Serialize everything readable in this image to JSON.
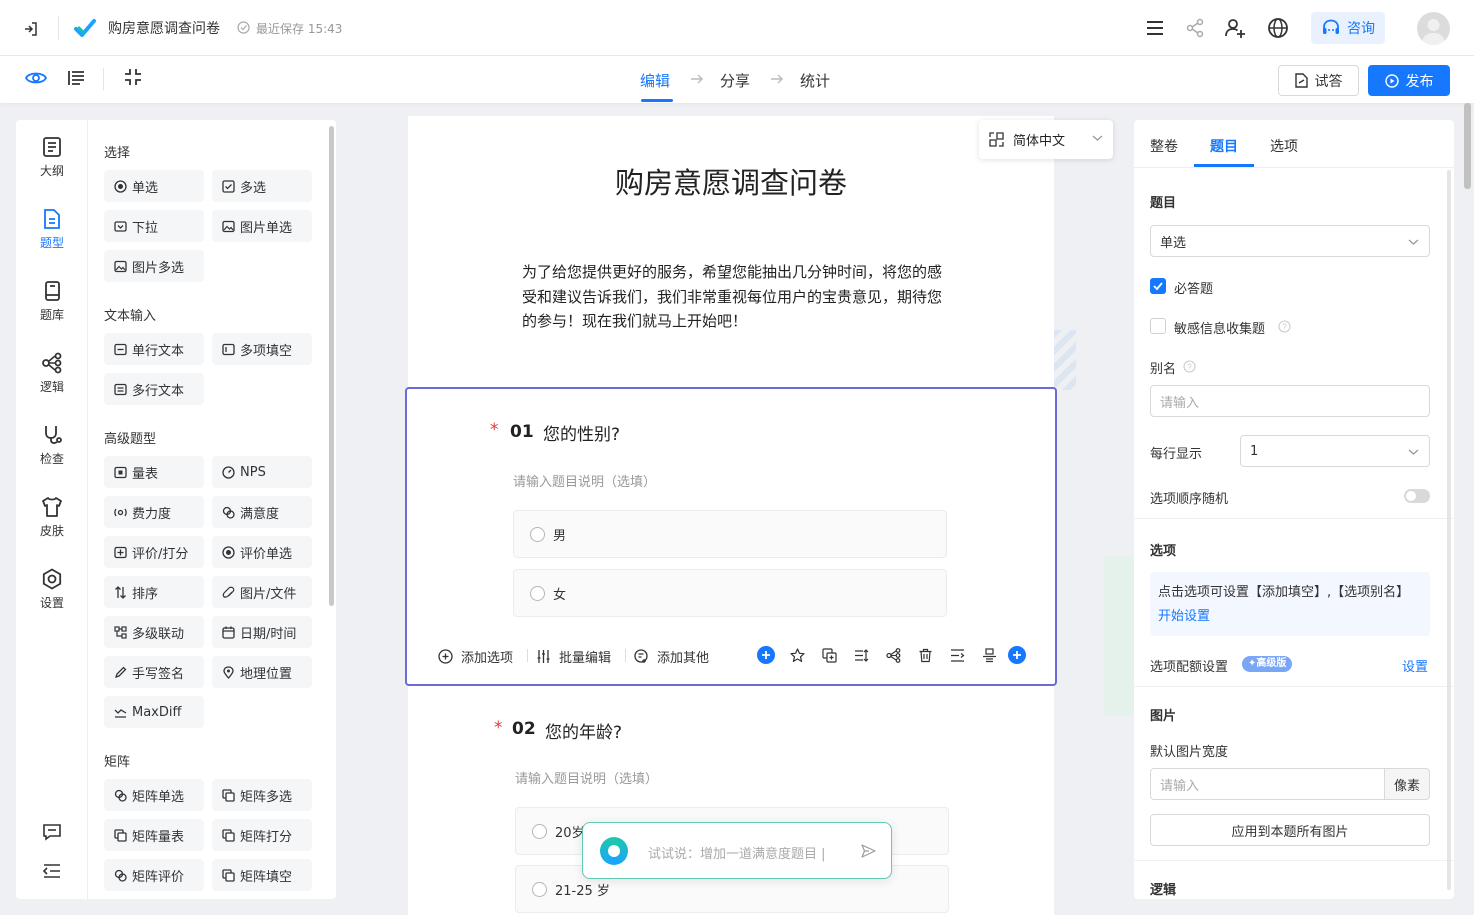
{
  "header": {
    "title": "购房意愿调查问卷",
    "save_status": "最近保存 15:43",
    "consult_label": "咨询"
  },
  "steps": [
    {
      "label": "编辑",
      "active": true
    },
    {
      "label": "分享",
      "active": false
    },
    {
      "label": "统计",
      "active": false
    }
  ],
  "actions": {
    "trial_label": "试答",
    "publish_label": "发布"
  },
  "leftnav": [
    {
      "label": "大纲",
      "icon": "outline-icon"
    },
    {
      "label": "题型",
      "icon": "question-type-icon",
      "active": true
    },
    {
      "label": "题库",
      "icon": "question-bank-icon"
    },
    {
      "label": "逻辑",
      "icon": "logic-icon"
    },
    {
      "label": "检查",
      "icon": "check-icon"
    },
    {
      "label": "皮肤",
      "icon": "skin-icon"
    },
    {
      "label": "设置",
      "icon": "settings-icon"
    }
  ],
  "palette": {
    "choice": {
      "title": "选择",
      "items": [
        "单选",
        "多选",
        "下拉",
        "图片单选",
        "图片多选"
      ]
    },
    "text": {
      "title": "文本输入",
      "items": [
        "单行文本",
        "多项填空",
        "多行文本"
      ]
    },
    "advanced": {
      "title": "高级题型",
      "items": [
        "量表",
        "NPS",
        "费力度",
        "满意度",
        "评价/打分",
        "评价单选",
        "排序",
        "图片/文件",
        "多级联动",
        "日期/时间",
        "手写签名",
        "地理位置",
        "MaxDiff"
      ]
    },
    "matrix": {
      "title": "矩阵",
      "items": [
        "矩阵单选",
        "矩阵多选",
        "矩阵量表",
        "矩阵打分",
        "矩阵评价",
        "矩阵填空"
      ]
    }
  },
  "survey": {
    "language": "简体中文",
    "title": "购房意愿调查问卷",
    "intro": "为了给您提供更好的服务，希望您能抽出几分钟时间，将您的感受和建议告诉我们，我们非常重视每位用户的宝贵意见，期待您的参与！现在我们就马上开始吧！",
    "q1": {
      "num": "01",
      "text": "您的性别?",
      "desc_placeholder": "请输入题目说明（选填）",
      "options": [
        "男",
        "女"
      ]
    },
    "q2": {
      "num": "02",
      "text": "您的年龄?",
      "desc_placeholder": "请输入题目说明（选填）",
      "options": [
        "20岁",
        "21-25 岁"
      ]
    },
    "toolbar": {
      "add_option": "添加选项",
      "batch_edit": "批量编辑",
      "add_other": "添加其他"
    }
  },
  "ai_input": {
    "placeholder": "试试说：增加一道满意度题目 |"
  },
  "right_panel": {
    "tabs": [
      "整卷",
      "题目",
      "选项"
    ],
    "active_tab": 1,
    "question_label": "题目",
    "question_type": "单选",
    "required_label": "必答题",
    "required": true,
    "sensitive_label": "敏感信息收集题",
    "sensitive": false,
    "alias_label": "别名",
    "alias_placeholder": "请输入",
    "per_row_label": "每行显示",
    "per_row_value": "1",
    "random_label": "选项顺序随机",
    "random": false,
    "options_title": "选项",
    "options_tip": "点击选项可设置【添加填空】,【选项别名】",
    "options_tip_link": "开始设置",
    "quota_label": "选项配额设置",
    "quota_badge": "高级版",
    "quota_link": "设置",
    "image_title": "图片",
    "img_width_label": "默认图片宽度",
    "img_width_placeholder": "请输入",
    "img_unit": "像素",
    "apply_all": "应用到本题所有图片",
    "logic_title": "逻辑"
  },
  "colors": {
    "accent": "#1677ff",
    "selection": "#6b6bd6",
    "required": "#e53935"
  }
}
